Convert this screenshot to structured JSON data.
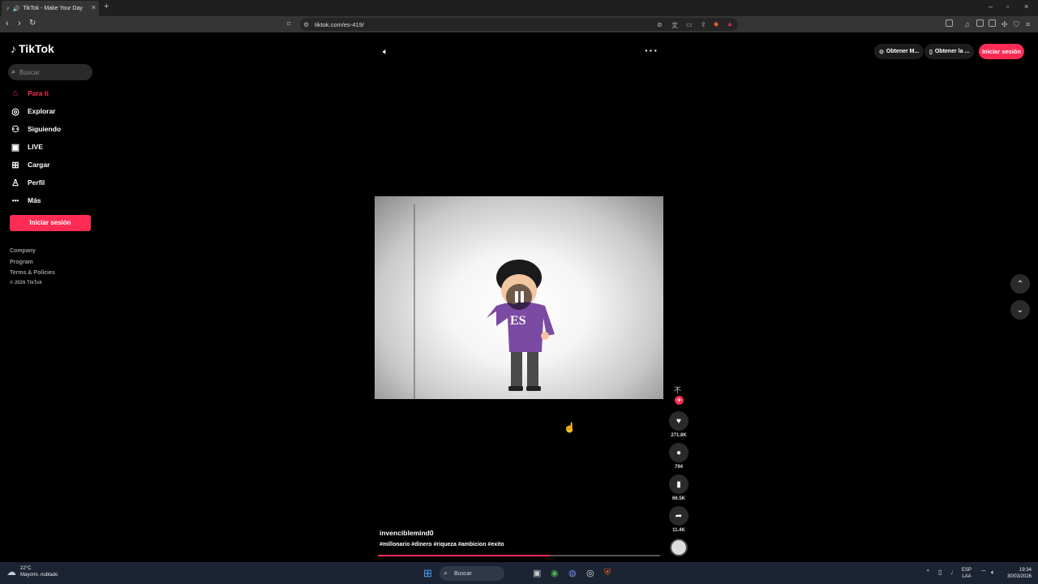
{
  "browser": {
    "tab_title": "TikTok - Make Your Day",
    "new_tab": "+",
    "url": "tiktok.com/es-419/",
    "window_controls": [
      "minimize",
      "restore",
      "close"
    ]
  },
  "sidebar": {
    "logo": "TikTok",
    "search_placeholder": "Buscar",
    "items": [
      {
        "label": "Para ti",
        "icon": "home-icon",
        "active": true
      },
      {
        "label": "Explorar",
        "icon": "compass-icon"
      },
      {
        "label": "Siguiendo",
        "icon": "following-icon"
      },
      {
        "label": "LIVE",
        "icon": "live-icon"
      },
      {
        "label": "Cargar",
        "icon": "upload-icon"
      },
      {
        "label": "Perfil",
        "icon": "profile-icon"
      },
      {
        "label": "Más",
        "icon": "more-dots-icon"
      }
    ],
    "login_button": "Iniciar sesión",
    "footer": [
      "Company",
      "Program",
      "Terms & Policies"
    ],
    "copyright": "© 2026 TikTok"
  },
  "topbar": {
    "get_button_1": "Obtener M...",
    "get_button_2": "Obtener la ...",
    "login_button": "Iniciar sesión"
  },
  "video": {
    "overlay_text": "ES",
    "author": "invenciblemind0",
    "hashtags": "#millonario #dinero #riqueza #ambicion #exito",
    "progress_percent": 61,
    "likes": "271.8K",
    "comments": "794",
    "saves": "66.5K",
    "shares": "11.4K"
  },
  "taskbar": {
    "temperature": "22°C",
    "weather": "Mayorm. nublado",
    "search": "Buscar",
    "language_1": "ESP",
    "language_2": "LAA",
    "time": "19:34",
    "date": "30/03/2026"
  },
  "colors": {
    "accent": "#fe2c55",
    "background": "#000000",
    "taskbar": "#1c2433"
  }
}
